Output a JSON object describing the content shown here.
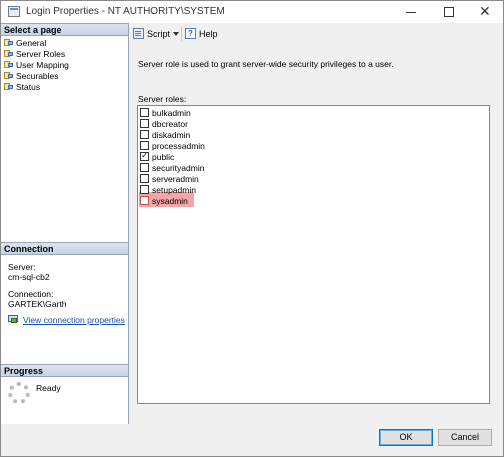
{
  "window": {
    "title": "Login Properties - NT AUTHORITY\\SYSTEM",
    "minimize": "",
    "maximize": "",
    "close": "✕"
  },
  "sidebar": {
    "select_page_header": "Select a page",
    "pages": [
      {
        "label": "General",
        "icon": "page-icon"
      },
      {
        "label": "Server Roles",
        "icon": "page-icon"
      },
      {
        "label": "User Mapping",
        "icon": "page-icon"
      },
      {
        "label": "Securables",
        "icon": "page-icon"
      },
      {
        "label": "Status",
        "icon": "page-icon"
      }
    ],
    "connection": {
      "header": "Connection",
      "server_label": "Server:",
      "server_value": "cm-sql-cb2",
      "connection_label": "Connection:",
      "connection_value": "GARTEK\\Garth",
      "link_text": "View connection properties"
    },
    "progress": {
      "header": "Progress",
      "status": "Ready"
    }
  },
  "toolbar": {
    "script_label": "Script",
    "help_label": "Help"
  },
  "main": {
    "description": "Server role is used to grant server-wide security privileges to a user.",
    "roles_label": "Server roles:",
    "roles": [
      {
        "name": "bulkadmin",
        "checked": false
      },
      {
        "name": "dbcreator",
        "checked": false
      },
      {
        "name": "diskadmin",
        "checked": false
      },
      {
        "name": "processadmin",
        "checked": false
      },
      {
        "name": "public",
        "checked": true
      },
      {
        "name": "securityadmin",
        "checked": false
      },
      {
        "name": "serveradmin",
        "checked": false
      },
      {
        "name": "setupadmin",
        "checked": false
      },
      {
        "name": "sysadmin",
        "checked": false,
        "highlighted": true
      }
    ],
    "highlight_color": "#f4a6a6"
  },
  "footer": {
    "ok_label": "OK",
    "cancel_label": "Cancel"
  }
}
